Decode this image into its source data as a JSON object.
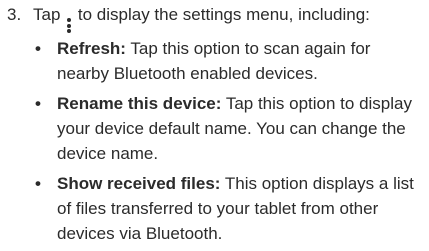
{
  "step": {
    "number": "3.",
    "text_before_icon": "Tap",
    "icon": "more-options-icon",
    "text_after_icon": "to display the settings menu, including:"
  },
  "options": [
    {
      "term": "Refresh:",
      "description": "Tap this option to scan again for nearby Bluetooth enabled devices."
    },
    {
      "term": "Rename this device:",
      "description": "Tap this option to display your device default name. You can change the device name."
    },
    {
      "term": "Show received files:",
      "description": "This option displays a list of files transferred to your tablet from other devices via Bluetooth."
    }
  ]
}
